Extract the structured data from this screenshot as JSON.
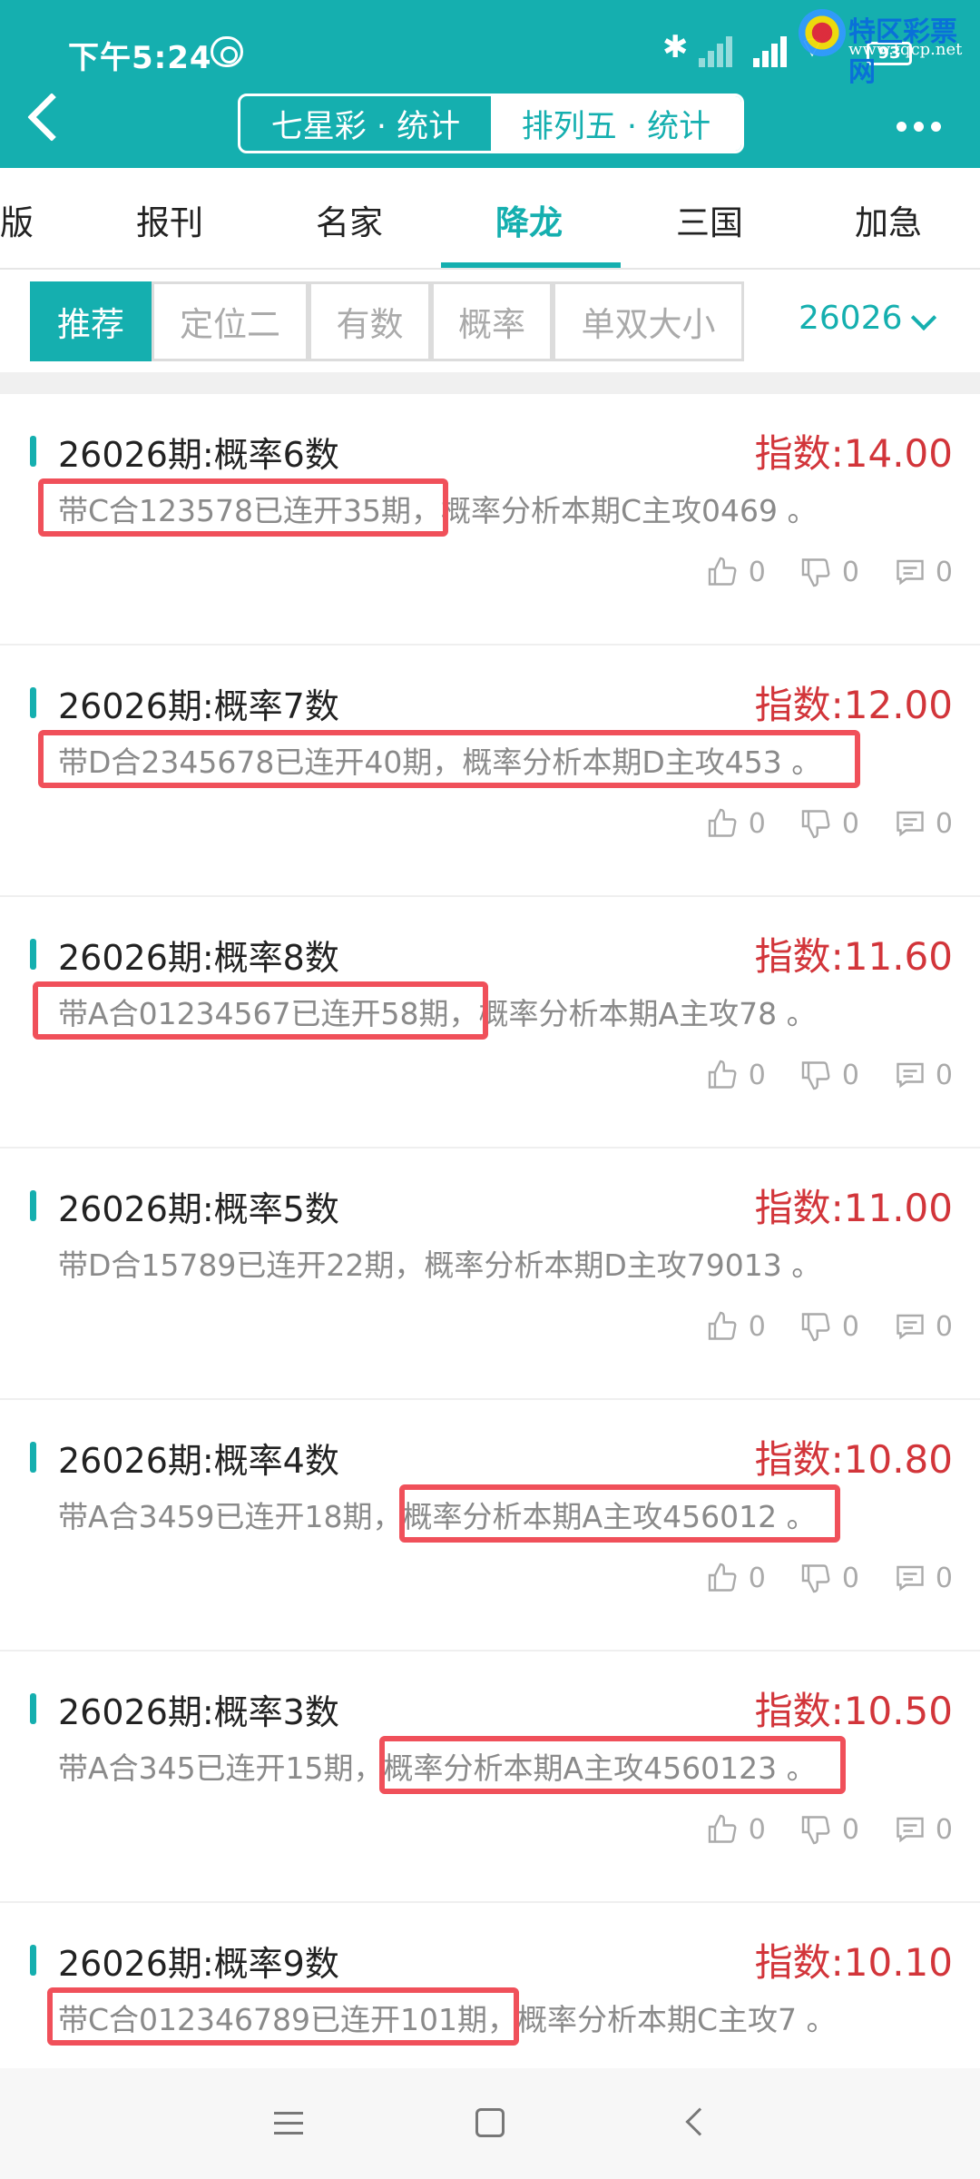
{
  "status_bar": {
    "time": "下午5:24",
    "battery": "93"
  },
  "watermark": {
    "name": "特区彩票网",
    "url": "www.tqcp.net"
  },
  "header": {
    "segments": [
      {
        "label": "七星彩 · 统计",
        "active": false
      },
      {
        "label": "排列五 · 统计",
        "active": true
      }
    ]
  },
  "tabs": [
    {
      "label": "版",
      "active": false
    },
    {
      "label": "报刊",
      "active": false
    },
    {
      "label": "名家",
      "active": false
    },
    {
      "label": "降龙",
      "active": true
    },
    {
      "label": "三国",
      "active": false
    },
    {
      "label": "加急",
      "active": false
    }
  ],
  "filters": {
    "chips": [
      {
        "label": "推荐",
        "active": true
      },
      {
        "label": "定位二",
        "active": false
      },
      {
        "label": "有数",
        "active": false
      },
      {
        "label": "概率",
        "active": false
      },
      {
        "label": "单双大小",
        "active": false
      }
    ],
    "period": "26026"
  },
  "cards": [
    {
      "title": "26026期:概率6数",
      "index": "指数:14.00",
      "desc": "带C合123578已连开35期，概率分析本期C主攻0469 。",
      "likes": "0",
      "dislikes": "0",
      "comments": "0"
    },
    {
      "title": "26026期:概率7数",
      "index": "指数:12.00",
      "desc": "带D合2345678已连开40期，概率分析本期D主攻453 。",
      "likes": "0",
      "dislikes": "0",
      "comments": "0"
    },
    {
      "title": "26026期:概率8数",
      "index": "指数:11.60",
      "desc": "带A合01234567已连开58期，概率分析本期A主攻78 。",
      "likes": "0",
      "dislikes": "0",
      "comments": "0"
    },
    {
      "title": "26026期:概率5数",
      "index": "指数:11.00",
      "desc": "带D合15789已连开22期，概率分析本期D主攻79013 。",
      "likes": "0",
      "dislikes": "0",
      "comments": "0"
    },
    {
      "title": "26026期:概率4数",
      "index": "指数:10.80",
      "desc": "带A合3459已连开18期，概率分析本期A主攻456012 。",
      "likes": "0",
      "dislikes": "0",
      "comments": "0"
    },
    {
      "title": "26026期:概率3数",
      "index": "指数:10.50",
      "desc": "带A合345已连开15期，概率分析本期A主攻4560123 。",
      "likes": "0",
      "dislikes": "0",
      "comments": "0"
    },
    {
      "title": "26026期:概率9数",
      "index": "指数:10.10",
      "desc": "带C合012346789已连开101期，概率分析本期C主攻7 。",
      "likes": "0",
      "dislikes": "0",
      "comments": "0"
    }
  ],
  "colors": {
    "accent": "#15AFAF",
    "index_red": "#D2353A",
    "highlight_box": "#F0505A"
  }
}
